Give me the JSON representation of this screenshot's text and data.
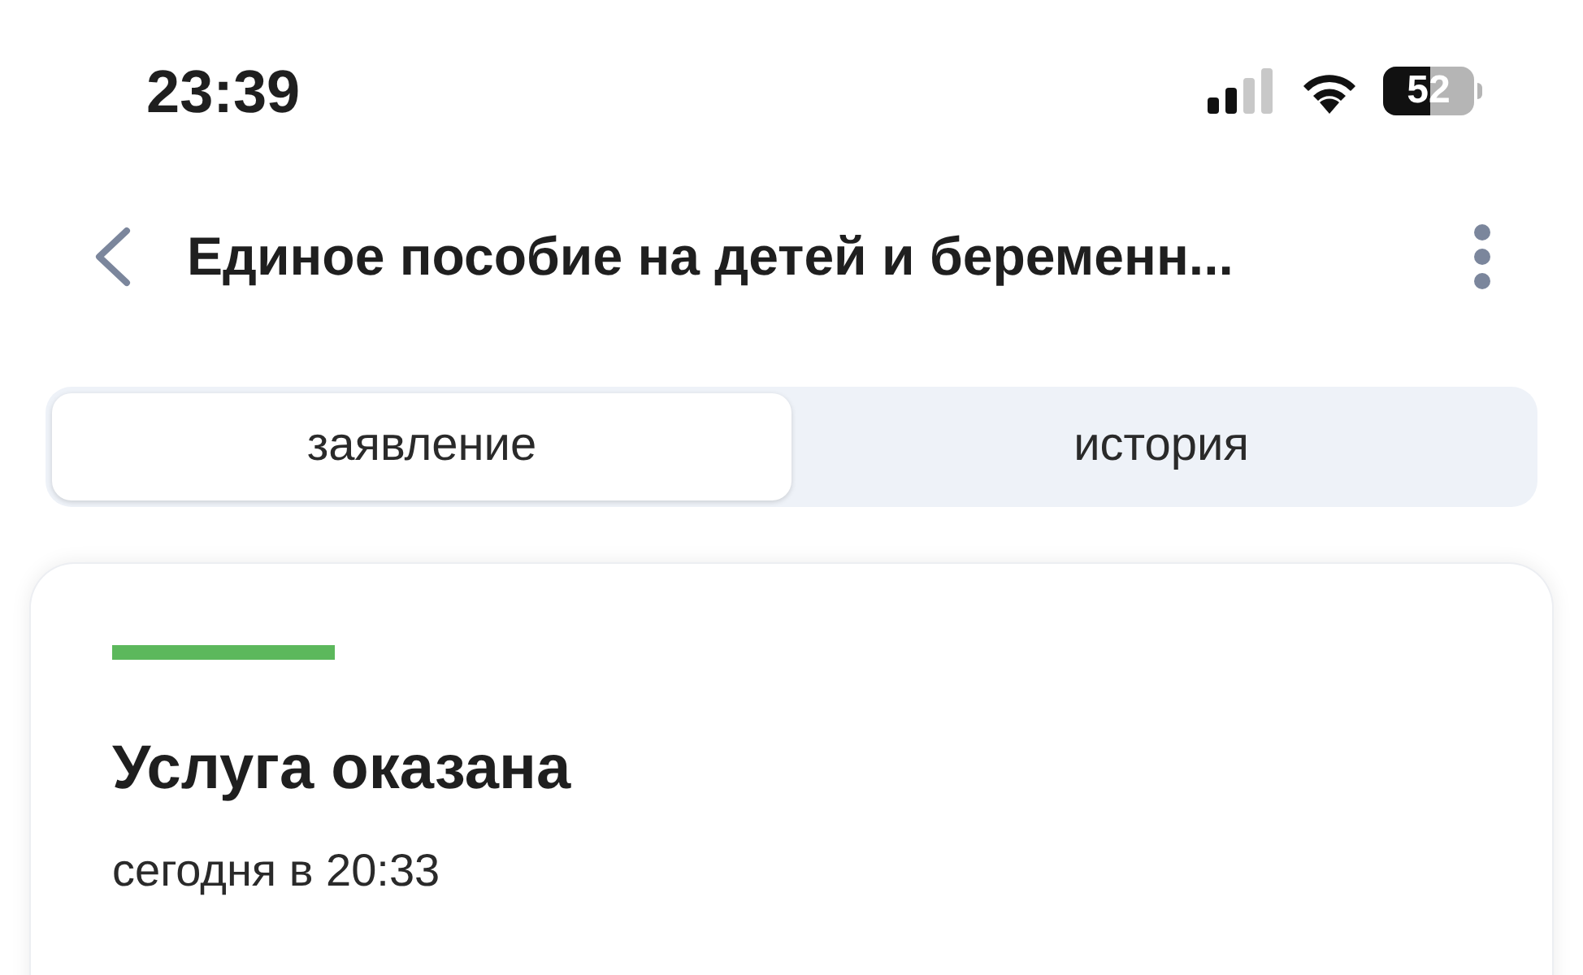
{
  "status_bar": {
    "time": "23:39",
    "battery": "52"
  },
  "header": {
    "title": "Единое пособие на детей и беременн..."
  },
  "tabs": [
    {
      "label": "заявление",
      "selected": true
    },
    {
      "label": "история",
      "selected": false
    }
  ],
  "status_card": {
    "color": "#5cb85c",
    "title": "Услуга оказана",
    "date": "сегодня в 20:33"
  }
}
